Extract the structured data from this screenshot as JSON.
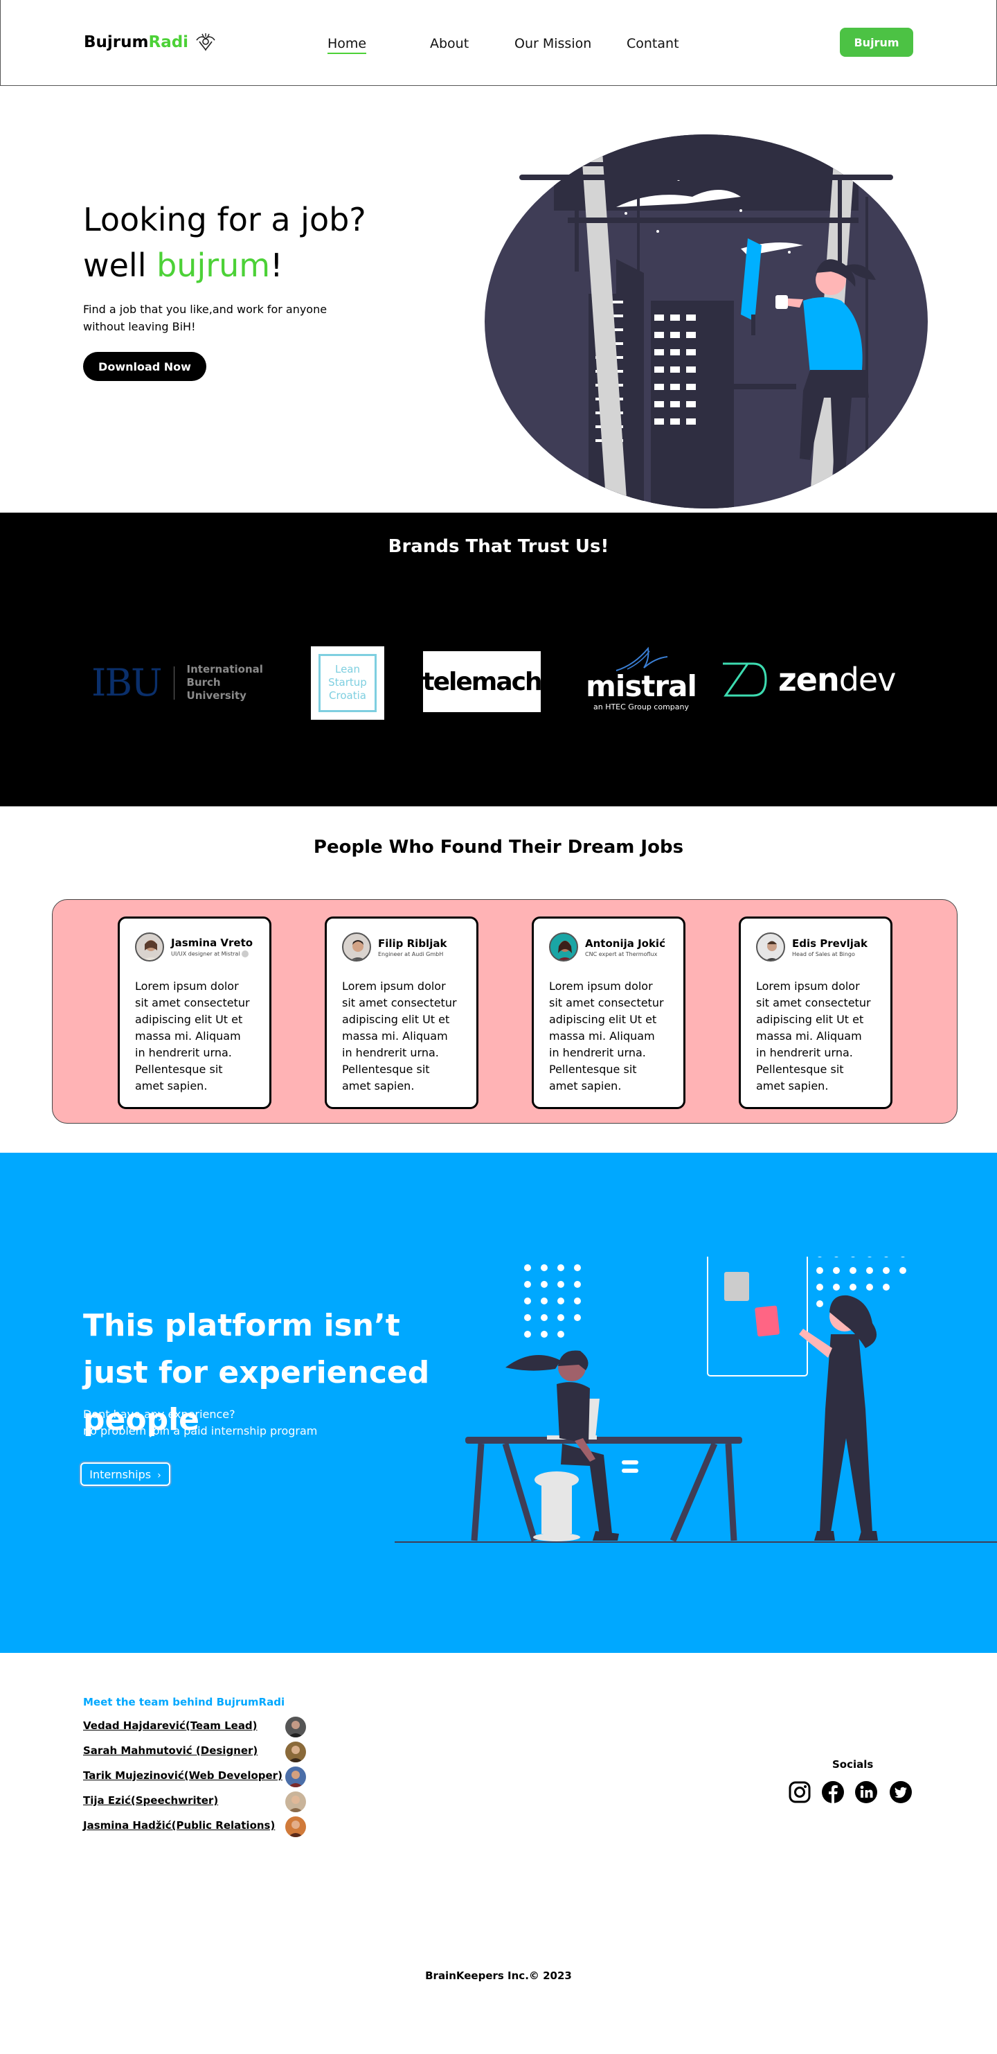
{
  "colors": {
    "green": "#4cd137",
    "black": "#000000",
    "blue": "#00a8ff",
    "pink": "#ffb3b5"
  },
  "nav": {
    "logo_main": "Bujrum",
    "logo_accent": "Radi",
    "links": [
      "Home",
      "About",
      "Our Mission",
      "Contant"
    ],
    "cta": "Bujrum"
  },
  "hero": {
    "title_line1": "Looking for a job?",
    "title_line2_pre": "well ",
    "title_line2_accent": "bujrum",
    "title_line2_post": "!",
    "text": "Find a job that you like,and work for anyone without leaving BiH!",
    "button": "Download Now"
  },
  "brands": {
    "title": "Brands That Trust Us!",
    "items": [
      {
        "name": "IBU",
        "sub": [
          "International",
          "Burch",
          "University"
        ]
      },
      {
        "name": "Lean Startup Croatia",
        "lines": [
          "Lean",
          "Startup",
          "Croatia"
        ]
      },
      {
        "name": "telemach"
      },
      {
        "name": "mistral",
        "sub": "an HTEC Group company"
      },
      {
        "name": "zendev",
        "prefix": "zen",
        "suffix": "dev"
      }
    ]
  },
  "people": {
    "title": "People Who  Found Their Dream Jobs",
    "cards": [
      {
        "name": "Jasmina Vreto",
        "role": "UI/UX designer at Mistral",
        "text": "Lorem ipsum dolor sit amet consectetur adipiscing elit Ut et massa mi. Aliquam in hendrerit urna. Pellentesque sit amet sapien."
      },
      {
        "name": "Filip Ribljak",
        "role": "Engineer at Audi GmbH",
        "text": "Lorem ipsum dolor sit amet consectetur adipiscing elit Ut et massa mi. Aliquam in hendrerit urna. Pellentesque sit amet sapien."
      },
      {
        "name": "Antonija Jokić",
        "role": "CNC expert at Thermoflux",
        "text": "Lorem ipsum dolor sit amet consectetur adipiscing elit Ut et massa mi. Aliquam in hendrerit urna. Pellentesque sit amet sapien."
      },
      {
        "name": "Edis Prevljak",
        "role": "Head of Sales at Bingo",
        "text": "Lorem ipsum dolor sit amet consectetur adipiscing elit Ut et massa mi. Aliquam in hendrerit urna. Pellentesque sit amet sapien."
      }
    ]
  },
  "platform": {
    "title": "This platform isn’t just for experienced people",
    "text_line1": "Dont have any experience?",
    "text_line2": "no problem join a paid internship program",
    "button": "Internships",
    "button_icon": "chevron-right-icon"
  },
  "footer": {
    "team_title": "Meet the team behind BujrumRadi",
    "members": [
      "Vedad Hajdarević(Team Lead)",
      "Sarah Mahmutović (Designer)",
      "Tarik Mujezinović(Web Developer)",
      "Tija Ezić(Speechwriter)",
      "Jasmina Hadžić(Public Relations)"
    ],
    "socials_title": "Socials",
    "socials": [
      "instagram-icon",
      "facebook-icon",
      "linkedin-icon",
      "twitter-icon"
    ],
    "copyright": "BrainKeepers Inc.© 2023"
  }
}
